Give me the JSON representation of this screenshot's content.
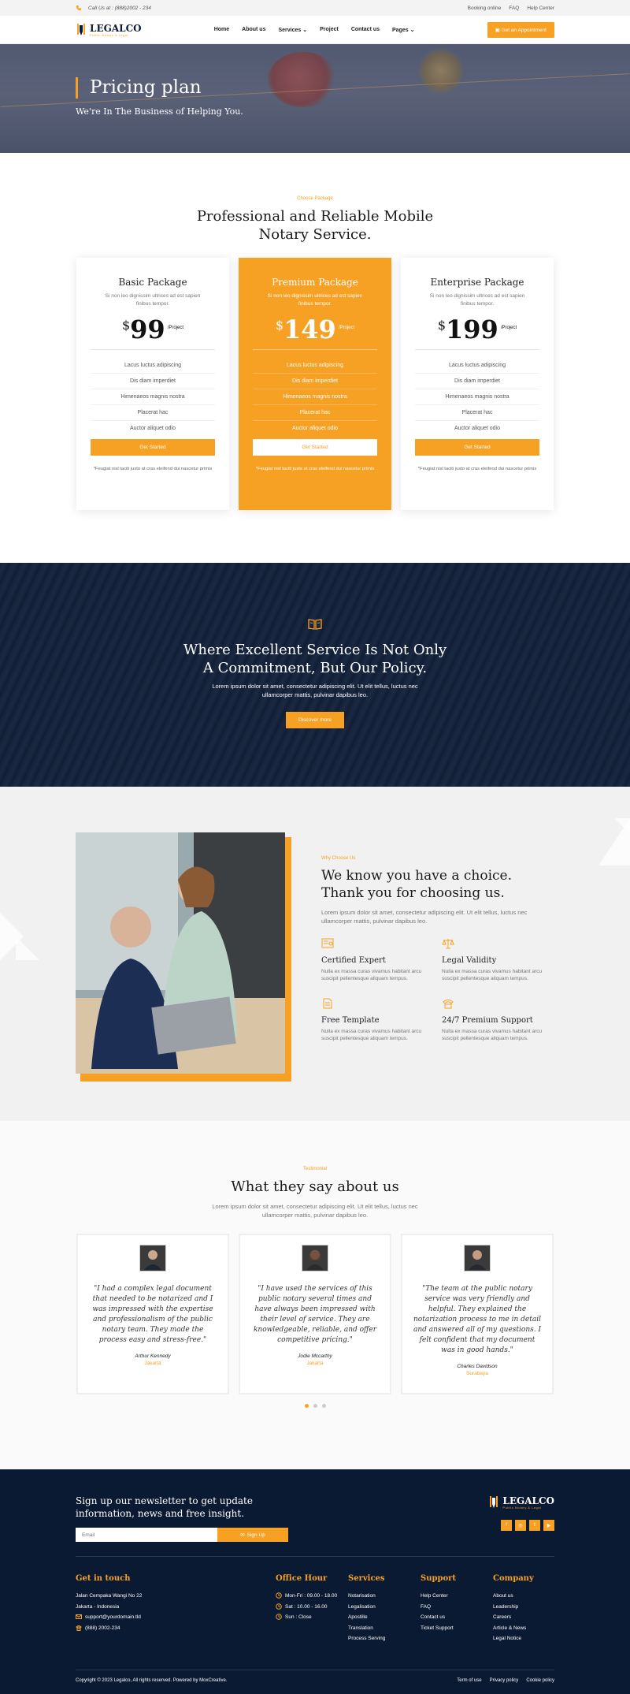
{
  "colors": {
    "accent": "#F7A124",
    "navy": "#0B1A33"
  },
  "topbar": {
    "call": "Call Us at : (888)2002 - 234",
    "links": [
      "Booking online",
      "FAQ",
      "Help Center"
    ]
  },
  "header": {
    "logo_name": "LEGALCO",
    "logo_tag": "Public Notary & Legal",
    "nav": [
      "Home",
      "About us",
      "Services",
      "Project",
      "Contact us",
      "Pages"
    ],
    "cta": "Get an Appointment"
  },
  "hero": {
    "title": "Pricing plan",
    "subtitle": "We're In The Business of Helping You."
  },
  "pricing": {
    "eyebrow": "Choose Package",
    "title_line1": "Professional and Reliable Mobile",
    "title_line2": "Notary Service.",
    "plans": [
      {
        "name": "Basic Package",
        "desc": "Si non leo dignissim ultrices ad est sapien finibus tempor.",
        "currency": "$",
        "price": "99",
        "per": "/Project",
        "features": [
          "Lacus luctus adipiscing",
          "Dis diam imperdiet",
          "Himenaeos magnis nostra",
          "Placerat hac",
          "Auctor aliquet odio"
        ],
        "cta": "Get Started",
        "note": "*Feugiat nisl taciti justo at cras eleifend dui nascetur primis"
      },
      {
        "name": "Premium Package",
        "desc": "Si non leo dignissim ultrices ad est sapien finibus tempor.",
        "currency": "$",
        "price": "149",
        "per": "/Project",
        "features": [
          "Lacus luctus adipiscing",
          "Dis diam imperdiet",
          "Himenaeos magnis nostra",
          "Placerat hac",
          "Auctor aliquet odio"
        ],
        "cta": "Get Started",
        "note": "*Feugiat nisl taciti justo at cras eleifend dui nascetur primis"
      },
      {
        "name": "Enterprise Package",
        "desc": "Si non leo dignissim ultrices ad est sapien finibus tempor.",
        "currency": "$",
        "price": "199",
        "per": "/Project",
        "features": [
          "Lacus luctus adipiscing",
          "Dis diam imperdiet",
          "Himenaeos magnis nostra",
          "Placerat hac",
          "Auctor aliquet odio"
        ],
        "cta": "Get Started",
        "note": "*Feugiat nisl taciti justo at cras eleifend dui nascetur primis"
      }
    ]
  },
  "banner": {
    "title_line1": "Where Excellent Service Is Not Only",
    "title_line2": "A Commitment, But Our Policy.",
    "text_line1": "Lorem ipsum dolor sit amet, consectetur adipiscing elit. Ut elit tellus, luctus nec",
    "text_line2": "ullamcorper mattis, pulvinar dapibus leo.",
    "cta": "Discover more"
  },
  "choice": {
    "eyebrow": "Why Choose Us",
    "title_line1": "We know you have a choice.",
    "title_line2": "Thank you for choosing us.",
    "lead": "Lorem ipsum dolor sit amet, consectetur adipiscing elit. Ut elit tellus, luctus nec ullamcorper mattis, pulvinar dapibus leo.",
    "features": [
      {
        "icon": "certificate-icon",
        "title": "Certified Expert",
        "text": "Nulla ex massa curas vivamus habitant arcu suscipit pellentesque aliquam tempus."
      },
      {
        "icon": "scales-icon",
        "title": "Legal Validity",
        "text": "Nulla ex massa curas vivamus habitant arcu suscipit pellentesque aliquam tempus."
      },
      {
        "icon": "document-icon",
        "title": "Free Template",
        "text": "Nulla ex massa curas vivamus habitant arcu suscipit pellentesque aliquam tempus."
      },
      {
        "icon": "phone-icon",
        "title": "24/7 Premium Support",
        "text": "Nulla ex massa curas vivamus habitant arcu suscipit pellentesque aliquam tempus."
      }
    ]
  },
  "testimonials": {
    "eyebrow": "Testimonial",
    "title": "What they say about us",
    "lead_line1": "Lorem ipsum dolor sit amet, consectetur adipiscing elit. Ut elit tellus, luctus nec",
    "lead_line2": "ullamcorper mattis, pulvinar dapibus leo.",
    "items": [
      {
        "quote": "\"I had a complex legal document that needed to be notarized and I was impressed with the expertise and professionalism of the public notary team. They made the process easy and stress-free.\"",
        "name": "Arthur Kennedy",
        "city": "Jakarta"
      },
      {
        "quote": "\"I have used the services of this public notary several times and have always been impressed with their level of service. They are knowledgeable, reliable, and offer competitive pricing.\"",
        "name": "Jodie Mccarthy",
        "city": "Jakarta"
      },
      {
        "quote": "\"The team at the public notary service was very friendly and helpful. They explained the notarization process to me in detail and answered all of my questions. I felt confident that my document was in good hands.\"",
        "name": "Charles Davidson",
        "city": "Surabaya"
      }
    ]
  },
  "footer": {
    "newsletter_line1": "Sign up our newsletter to get update",
    "newsletter_line2": "information, news and free insight.",
    "email_placeholder": "Email",
    "signup": "Sign Up",
    "logo_name": "LEGALCO",
    "logo_tag": "Public Notary & Legal",
    "touch_title": "Get in touch",
    "address1": "Jalan Cempaka Wangi No 22",
    "address2": "Jakarta - Indonesia",
    "email": "support@yourdomain.tld",
    "phone": "(888) 2002-234",
    "hours_title": "Office Hour",
    "hours": [
      "Mon-Fri : 09.00 - 18.00",
      "Sat : 10.00 - 16.00",
      "Sun : Close"
    ],
    "services_title": "Services",
    "services": [
      "Notarisation",
      "Legalisation",
      "Apostille",
      "Translation",
      "Process Serving"
    ],
    "support_title": "Support",
    "support": [
      "Help Center",
      "FAQ",
      "Contact us",
      "Ticket Support"
    ],
    "company_title": "Company",
    "company": [
      "About us",
      "Leadership",
      "Careers",
      "Article & News",
      "Legal Notice"
    ],
    "copyright": "Copyright © 2023 Legalco, All rights reserved. Powered by MoxCreative.",
    "legal": [
      "Term of use",
      "Privacy policy",
      "Cookie policy"
    ]
  }
}
